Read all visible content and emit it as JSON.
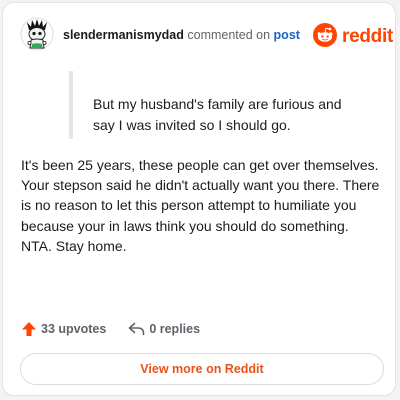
{
  "header": {
    "username": "slendermanismydad",
    "action_text": "commented on",
    "post_link": "post",
    "brand_word": "reddit"
  },
  "quote": {
    "text": "But my husband's family are furious and say I was invited so I should go."
  },
  "comment": {
    "text": "It's been 25 years, these people can get over themselves. Your stepson said he didn't actually want you there. There is no reason to let this person attempt to humiliate you because your in laws think you should do something. NTA. Stay home."
  },
  "actions": {
    "upvotes_label": "33 upvotes",
    "replies_label": "0 replies"
  },
  "footer": {
    "view_more_label": "View more on Reddit"
  },
  "icons": {
    "avatar": "user-avatar-icon",
    "brand": "reddit-snoo-icon",
    "upvote": "upvote-arrow-icon",
    "reply": "reply-arrow-icon"
  },
  "colors": {
    "brand_orange": "#ff4500",
    "link_blue": "#1a64c8",
    "upvote_orange": "#ff4500",
    "view_more_text": "#e8531b"
  }
}
